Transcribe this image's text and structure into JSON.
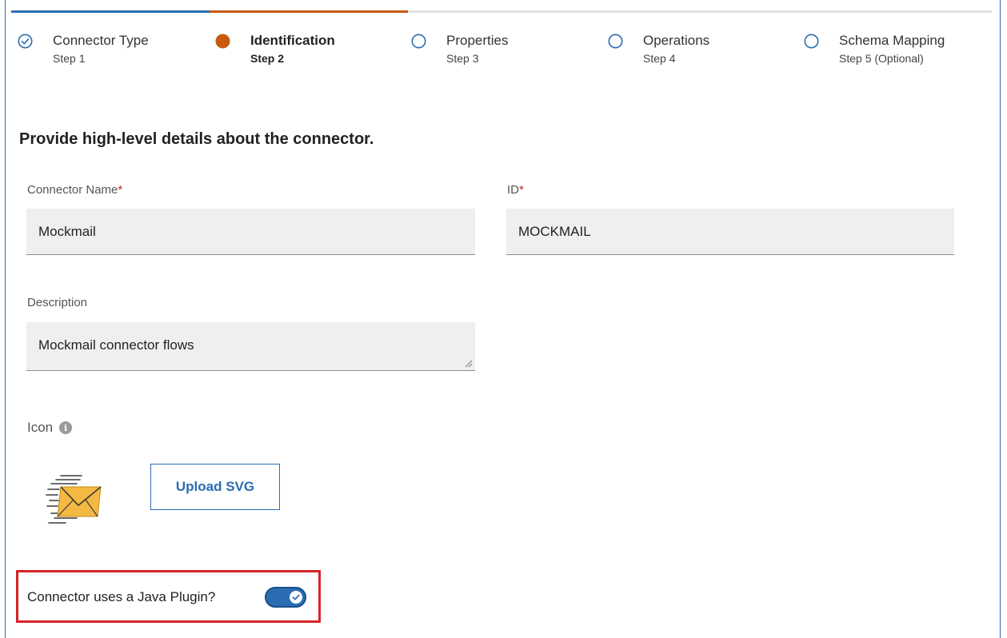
{
  "wizard": {
    "steps": [
      {
        "title": "Connector Type",
        "sub": "Step 1",
        "state": "completed"
      },
      {
        "title": "Identification",
        "sub": "Step 2",
        "state": "active"
      },
      {
        "title": "Properties",
        "sub": "Step 3",
        "state": "pending"
      },
      {
        "title": "Operations",
        "sub": "Step 4",
        "state": "pending"
      },
      {
        "title": "Schema Mapping",
        "sub": "Step 5 (Optional)",
        "state": "pending"
      }
    ]
  },
  "form": {
    "heading": "Provide high-level details about the connector.",
    "connector_name": {
      "label": "Connector Name",
      "required_mark": "*",
      "value": "Mockmail"
    },
    "id": {
      "label": "ID",
      "required_mark": "*",
      "value": "MOCKMAIL"
    },
    "description": {
      "label": "Description",
      "value": "Mockmail connector flows"
    },
    "icon": {
      "label": "Icon",
      "info_glyph": "i",
      "preview_icon": "mail-envelope-icon",
      "upload_label": "Upload SVG"
    },
    "java_plugin": {
      "label": "Connector uses a Java Plugin?",
      "enabled": true
    }
  },
  "colors": {
    "accent": "#2a6db3",
    "active_step": "#c85a10",
    "highlight": "#d6232a"
  }
}
